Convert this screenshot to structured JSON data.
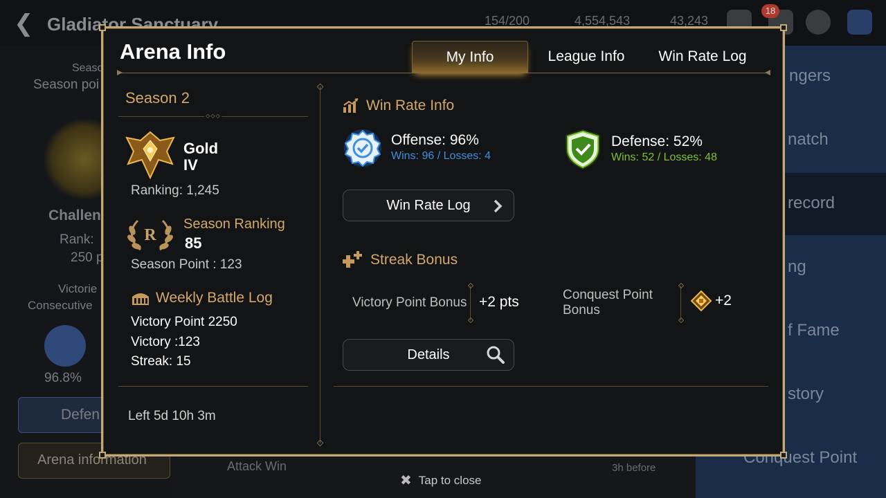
{
  "background": {
    "title": "Gladiator Sanctuary",
    "resources": [
      "154/200",
      "4,554,543",
      "43,243"
    ],
    "notification_count": "18",
    "left_labels": [
      "Season",
      "Season poi",
      "Challen",
      "Rank:",
      "250 p",
      "Victorie",
      "Consecutive",
      "96.8%",
      "Defen",
      "Arena information"
    ],
    "right_labels": [
      "ngers",
      "natch",
      "record",
      "ng",
      "f Fame",
      "story",
      "Conquest Point"
    ],
    "bottom_labels": [
      "Attack Win",
      "3h before"
    ]
  },
  "close_hint": "Tap to close",
  "modal": {
    "title": "Arena Info",
    "tabs": [
      {
        "label": "My Info",
        "active": true
      },
      {
        "label": "League Info",
        "active": false
      },
      {
        "label": "Win Rate Log",
        "active": false
      }
    ],
    "left": {
      "season": "Season 2",
      "tier_line1": "Gold",
      "tier_line2": "IV",
      "ranking": "Ranking: 1,245",
      "season_ranking_label": "Season Ranking",
      "season_ranking_value": "85",
      "laurel_letter": "R",
      "season_point": "Season Point : 123",
      "weekly_battle_log_label": "Weekly Battle Log",
      "weekly": [
        "Victory Point 2250",
        "Victory :123",
        "Streak: 15"
      ],
      "time_left": "Left 5d 10h 3m"
    },
    "right": {
      "win_rate_info_label": "Win Rate Info",
      "offense": {
        "title": "Offense: 96%",
        "sub": "Wins: 96 / Losses: 4",
        "color": "#3d8fe0"
      },
      "defense": {
        "title": "Defense: 52%",
        "sub": "Wins: 52 / Losses: 48",
        "color": "#7ec230"
      },
      "win_rate_log_button": "Win Rate Log",
      "streak_bonus_label": "Streak Bonus",
      "victory_point_bonus_label": "Victory Point Bonus",
      "victory_point_bonus_value": "+2 pts",
      "conquest_point_bonus_label_1": "Conquest Point",
      "conquest_point_bonus_label_2": "Bonus",
      "conquest_point_bonus_value": "+2",
      "details_button": "Details"
    }
  },
  "colors": {
    "accent_gold": "#d4a86a",
    "frame": "#c2a97a",
    "offense_blue": "#3d8fe0",
    "defense_green": "#7ec230"
  }
}
